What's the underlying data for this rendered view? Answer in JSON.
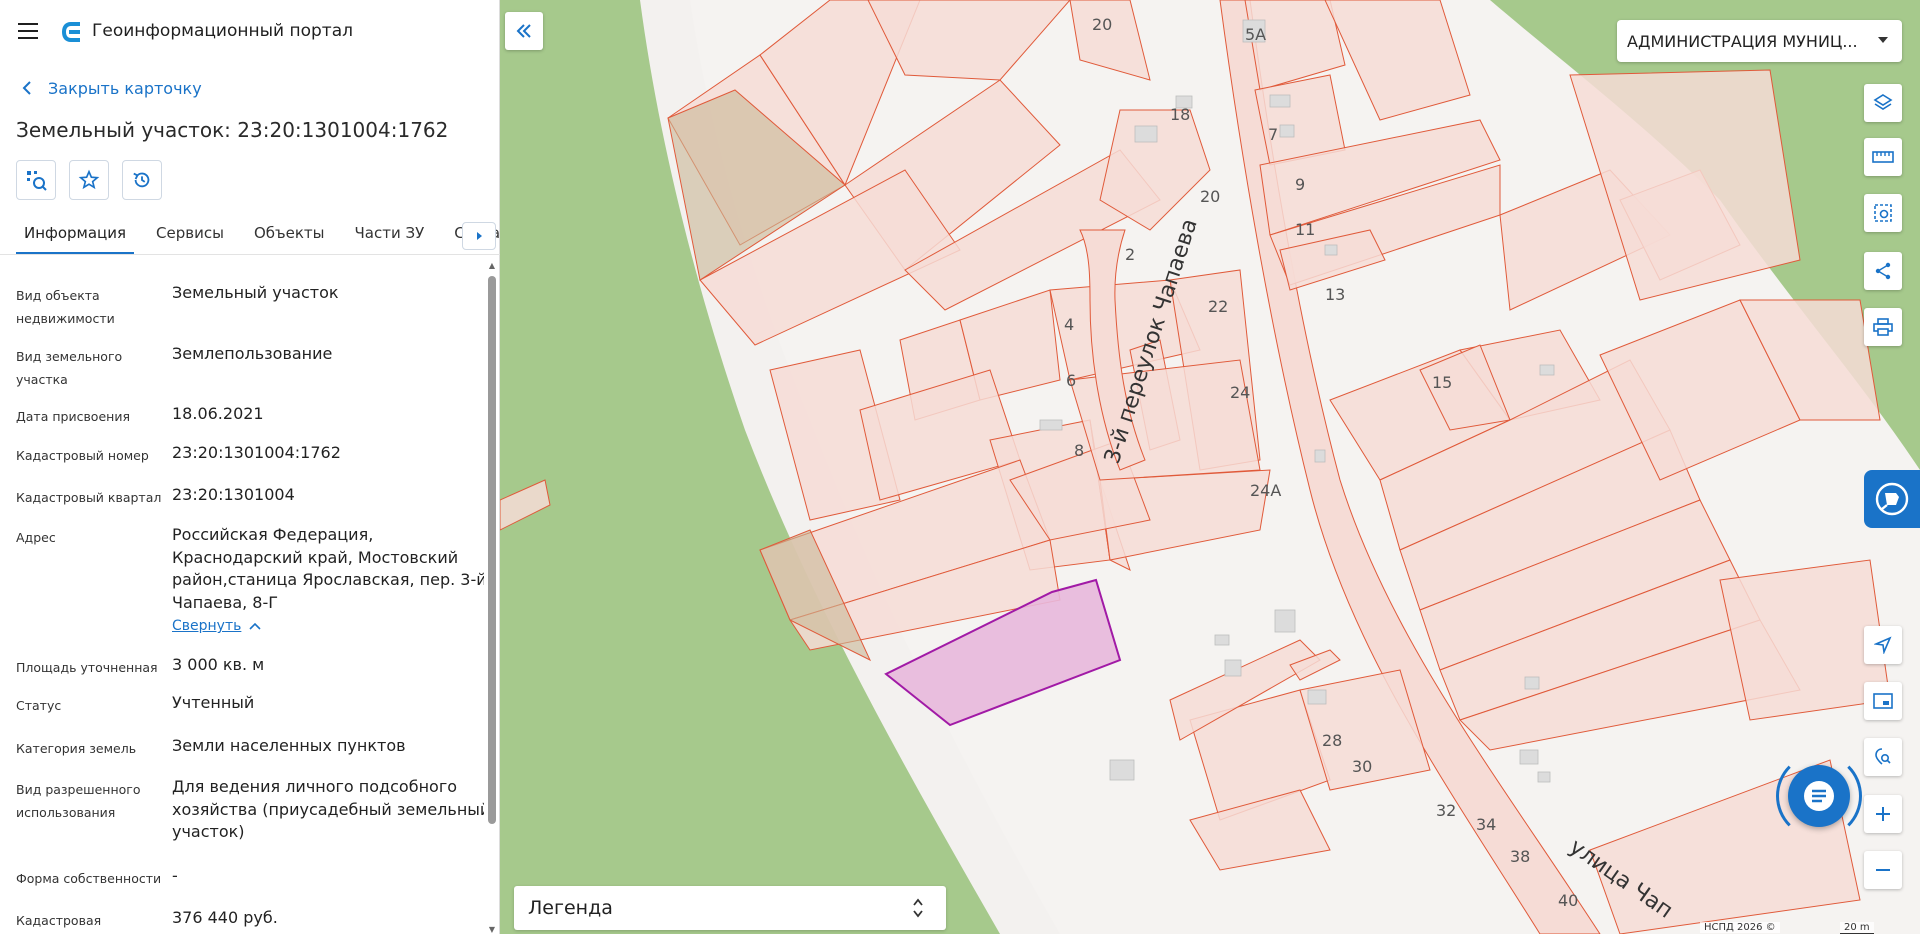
{
  "app": {
    "title": "Геоинформационный портал"
  },
  "card": {
    "back_label": "Закрыть карточку",
    "title": "Земельный участок: 23:20:1301004:1762"
  },
  "tabs": [
    {
      "label": "Информация",
      "active": true
    },
    {
      "label": "Сервисы"
    },
    {
      "label": "Объекты"
    },
    {
      "label": "Части ЗУ"
    },
    {
      "label": "Состав"
    }
  ],
  "info": {
    "rows": [
      {
        "key": "Вид объекта недвижимости",
        "value": "Земельный участок"
      },
      {
        "key": "Вид земельного участка",
        "value": "Землепользование"
      },
      {
        "key": "Дата присвоения",
        "value": "18.06.2021"
      },
      {
        "key": "Кадастровый номер",
        "value": "23:20:1301004:1762"
      },
      {
        "key": "Кадастровый квартал",
        "value": "23:20:1301004"
      },
      {
        "key": "Адрес",
        "value": "Российская Федерация, Краснодарский край, Мостовский район,станица Ярославская, пер. 3-й Чапаева, 8-Г"
      },
      {
        "key": "Площадь уточненная",
        "value": "3 000 кв. м"
      },
      {
        "key": "Статус",
        "value": "Учтенный"
      },
      {
        "key": "Категория земель",
        "value": "Земли населенных пунктов"
      },
      {
        "key": "Вид разрешенного использования",
        "value": "Для ведения личного подсобного хозяйства (приусадебный земельный участок)"
      },
      {
        "key": "Форма собственности",
        "value": "-"
      },
      {
        "key": "Кадастровая",
        "value": "376 440 руб."
      }
    ],
    "collapse_label": "Свернуть"
  },
  "map": {
    "org_select": "АДМИНИСТРАЦИЯ МУНИЦ...",
    "legend_label": "Легенда",
    "attribution": "НСПД 2026 ©",
    "scale": "20 m",
    "streets": [
      "3-й переулок Чапаева",
      "улица Чап"
    ],
    "house_numbers": [
      "20",
      "5А",
      "18",
      "7",
      "9",
      "20",
      "11",
      "2",
      "13",
      "22",
      "4",
      "15",
      "6",
      "24",
      "8",
      "24А",
      "28",
      "30",
      "32",
      "34",
      "38",
      "40"
    ],
    "colors": {
      "parcel_fill": "#f6dcd6",
      "parcel_stroke": "#e05a3a",
      "selected_fill": "#e8b8dc",
      "selected_stroke": "#a11aa6",
      "green": "#a6c98c",
      "accent": "#1a73c8"
    }
  },
  "icons": {
    "toolbar": [
      "layers-icon",
      "ruler-icon",
      "select-area-icon",
      "share-icon",
      "print-icon",
      "locate-icon",
      "minimap-icon",
      "search-location-icon",
      "zoom-in-icon",
      "zoom-out-icon"
    ],
    "card_actions": [
      "find-on-map-icon",
      "favorite-star-icon",
      "history-icon"
    ]
  }
}
